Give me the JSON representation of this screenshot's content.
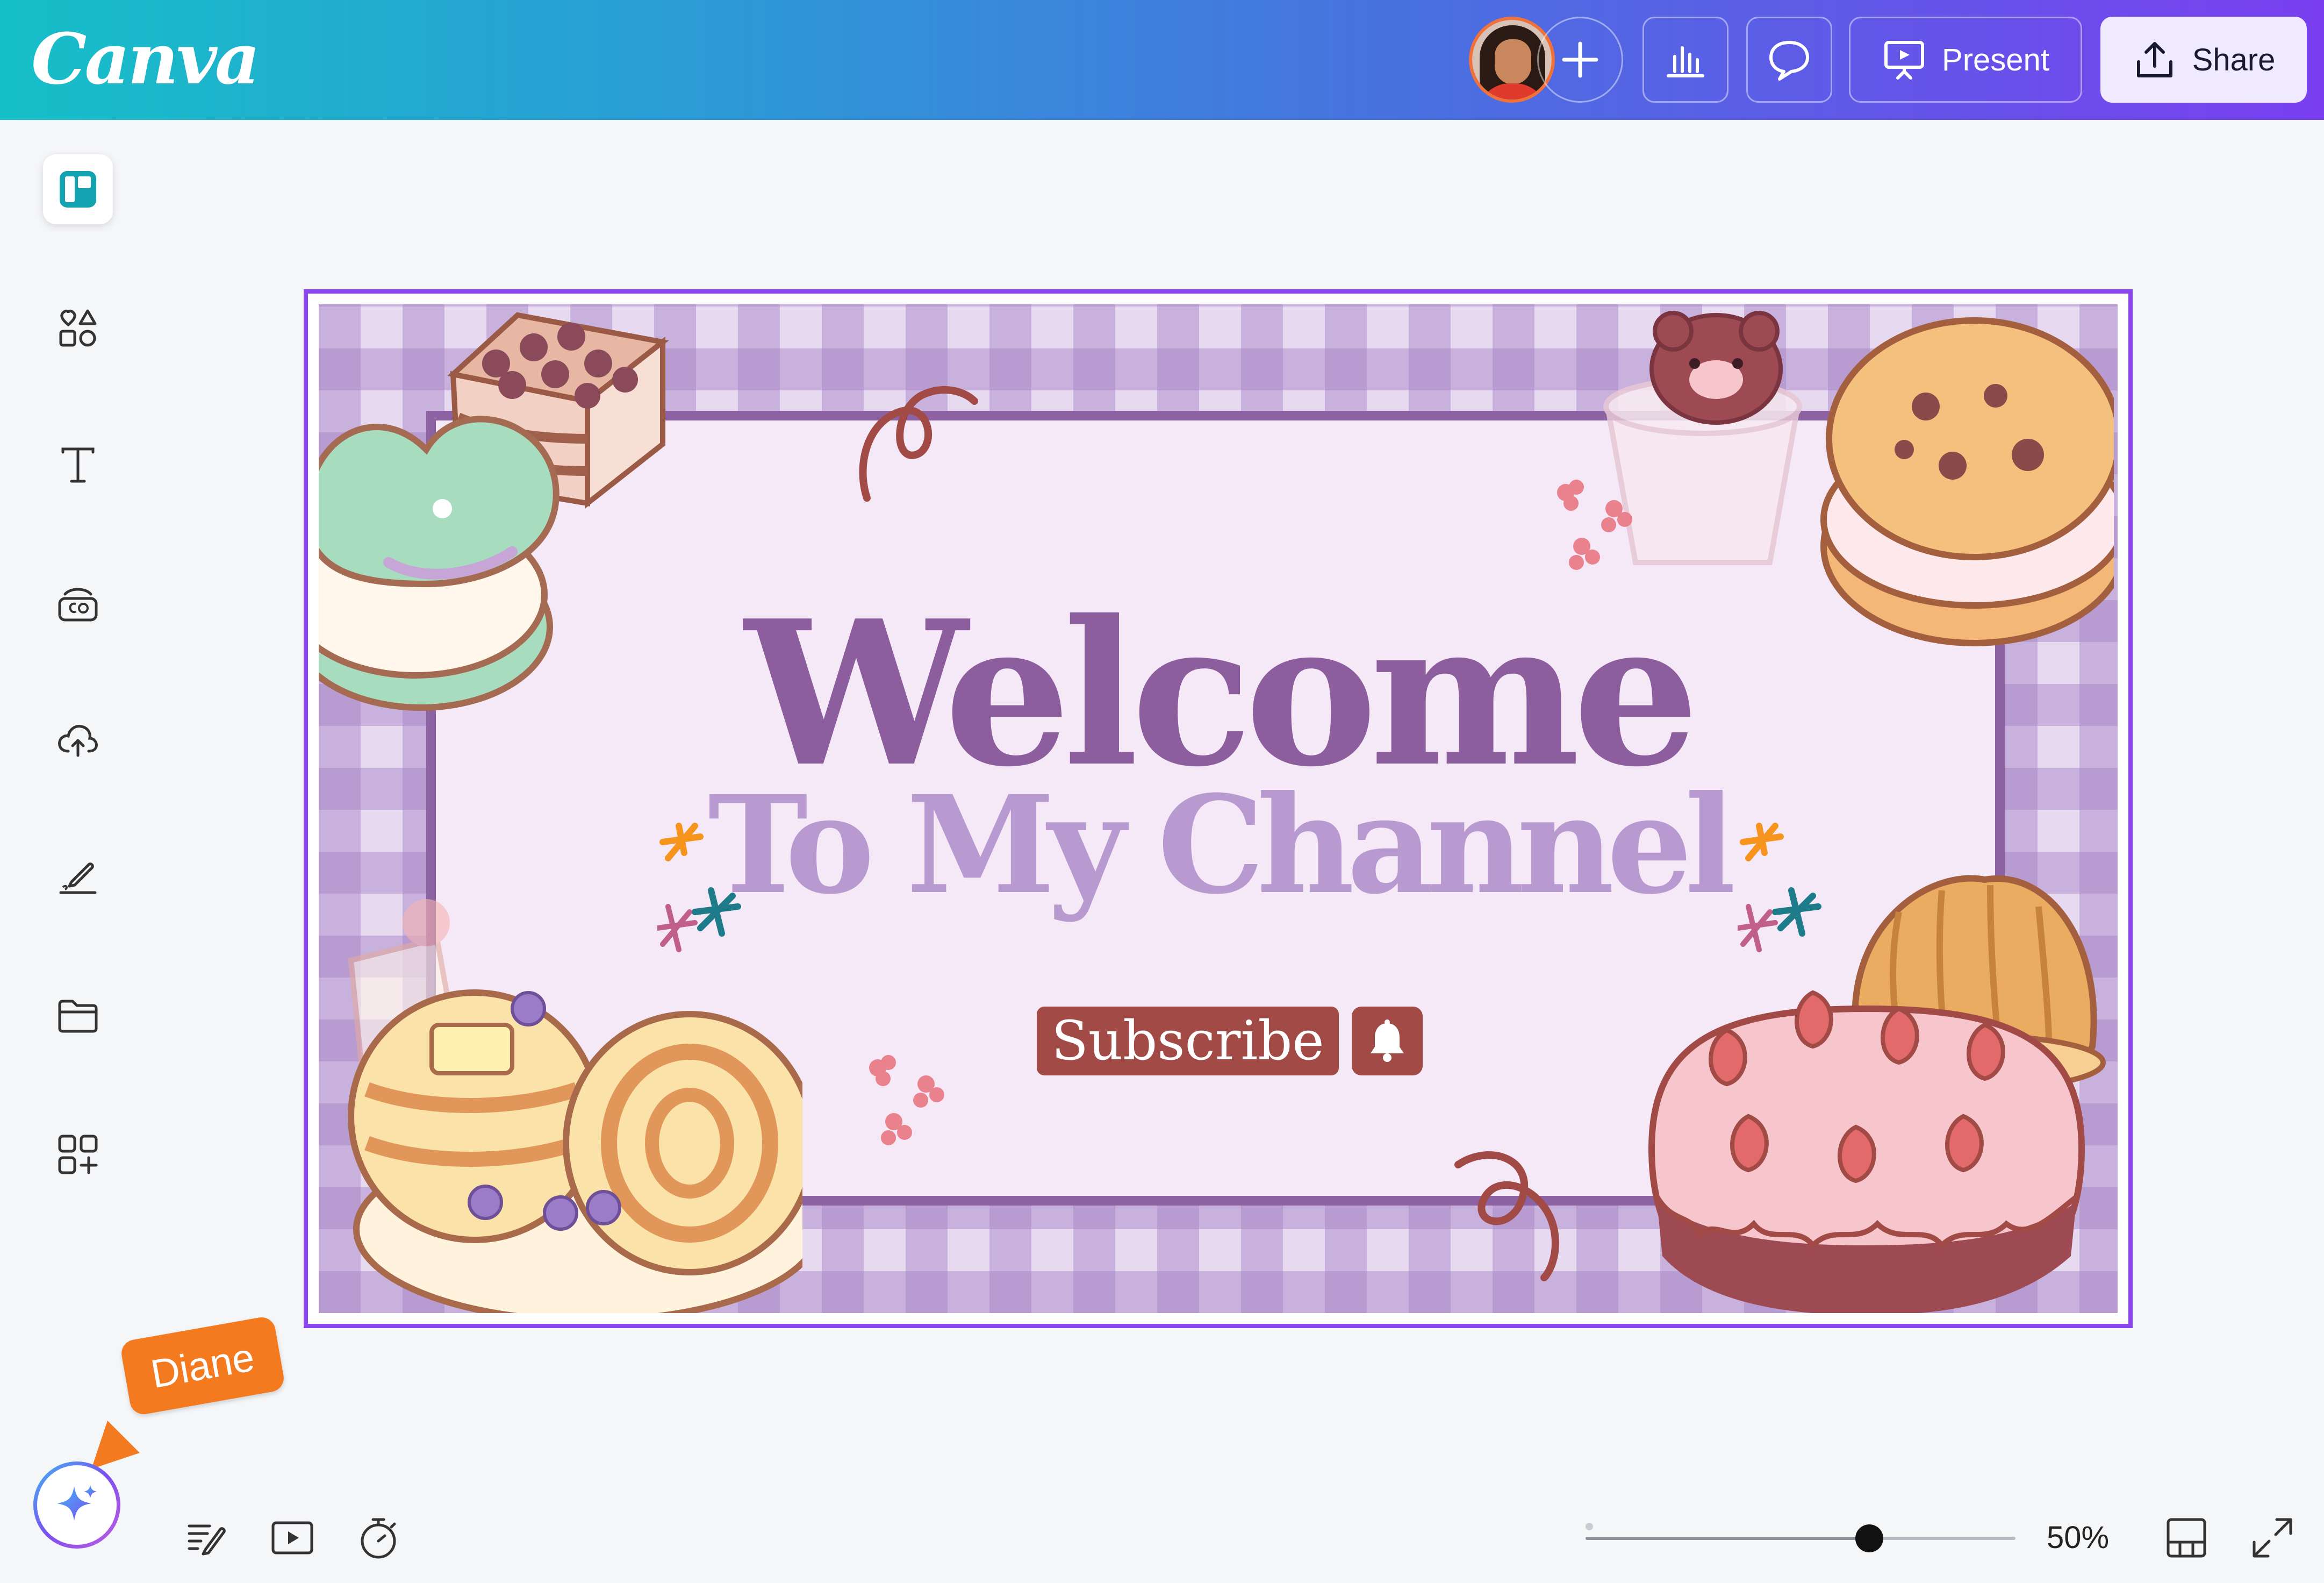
{
  "app": {
    "logo_text": "Canva",
    "brand_gradient": [
      "#16bfc7",
      "#7a3ff0"
    ],
    "accent_selection": "#8b45ef"
  },
  "header": {
    "avatar_icon": "user-avatar",
    "add_collaborator_icon": "plus-icon",
    "insights_icon": "bar-chart-icon",
    "comments_icon": "speech-bubble-icon",
    "present_icon": "presentation-screen-icon",
    "present_label": "Present",
    "share_icon": "upload-icon",
    "share_label": "Share"
  },
  "sidebar": {
    "items": [
      {
        "icon": "design-layout-icon",
        "active": true
      },
      {
        "icon": "elements-shapes-icon"
      },
      {
        "icon": "text-T-icon"
      },
      {
        "icon": "brand-co-icon"
      },
      {
        "icon": "cloud-upload-icon"
      },
      {
        "icon": "draw-pen-icon"
      },
      {
        "icon": "folder-icon"
      },
      {
        "icon": "apps-grid-plus-icon"
      }
    ]
  },
  "design": {
    "title_line1": "Welcome",
    "title_line2": "To My Channel",
    "subscribe_label": "Subscribe",
    "bell_icon": "bell-icon",
    "colors": {
      "title": "#8c5e9e",
      "subtitle": "#b99ad0",
      "button": "#a14a46",
      "panel": "#f5e8f7",
      "gingham": "#a480c4"
    }
  },
  "collaborator": {
    "name": "Diane",
    "color": "#f47a20"
  },
  "magic": {
    "icon": "sparkle-icon"
  },
  "footer": {
    "notes_icon": "notes-pencil-icon",
    "play_icon": "play-video-icon",
    "timer_icon": "timer-icon",
    "zoom_value": 0.5,
    "zoom_label": "50%",
    "grid_view_icon": "grid-view-icon",
    "fullscreen_icon": "expand-arrows-icon"
  }
}
